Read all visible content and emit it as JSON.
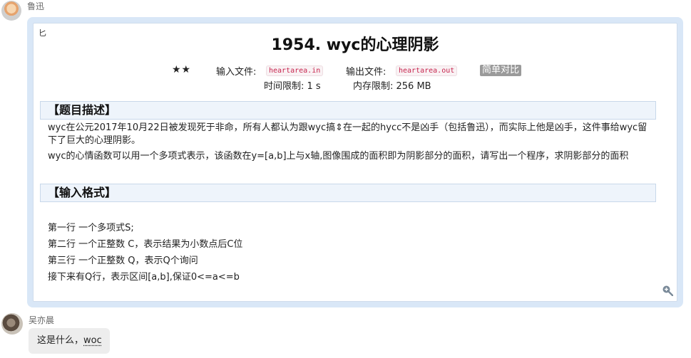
{
  "messages": [
    {
      "sender": "鲁迅",
      "card": {
        "corner_mark": "匕",
        "title": "1954. wyc的心理阴影",
        "difficulty": "★★",
        "input_file_label": "输入文件:",
        "input_file": "heartarea.in",
        "output_file_label": "输出文件:",
        "output_file": "heartarea.out",
        "diff_button": "简单对比",
        "time_limit": "时间限制: 1 s",
        "memory_limit": "内存限制: 256 MB",
        "section_description": "【题目描述】",
        "description_1": "wyc在公元2017年10月22日被发现死于非命，所有人都认为跟wyc搞⇕在一起的hycc不是凶手（包括鲁迅），而实际上他是凶手，这件事给wyc留下了巨大的心理阴影。",
        "description_2": "wyc的心情函数可以用一个多项式表示，该函数在y=[a,b]上与x轴,图像围成的面积即为阴影部分的面积，请写出一个程序，求阴影部分的面积",
        "section_input": "【输入格式】",
        "input_lines": [
          "第一行 一个多项式S;",
          "第二行 一个正整数 C，表示结果为小数点后C位",
          "第三行 一个正整数 Q，表示Q个询问",
          "接下来有Q行，表示区间[a,b],保证0<=a<=b"
        ]
      }
    },
    {
      "sender": "吴亦晨",
      "text_before": "这是什么，",
      "text_underlined": "woc"
    }
  ],
  "icons": {
    "zoom": "zoom-in-icon",
    "avatar_1": "avatar",
    "avatar_2": "avatar"
  }
}
